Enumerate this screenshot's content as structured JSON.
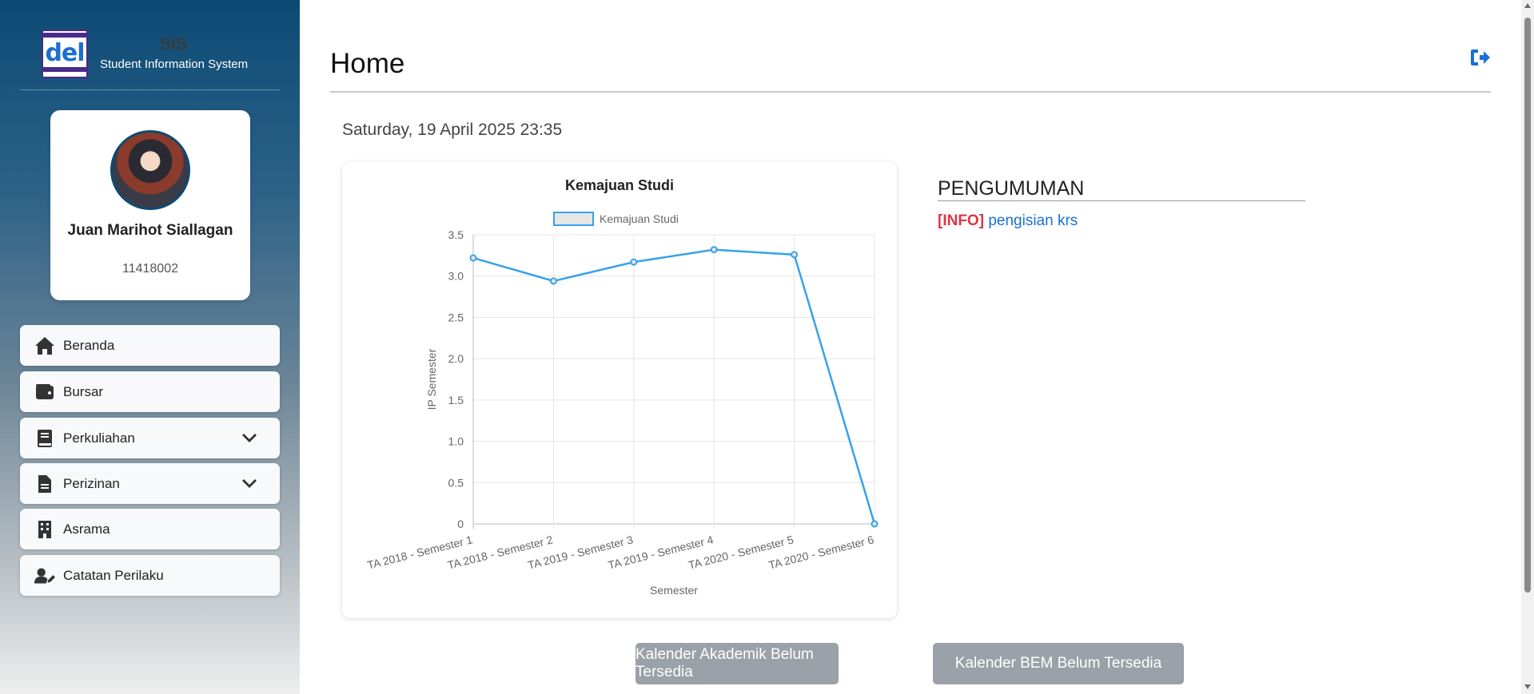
{
  "brand": {
    "logo_text": "del",
    "title": "SIS",
    "subtitle": "Student Information System"
  },
  "profile": {
    "name": "Juan Marihot Siallagan",
    "student_id": "11418002"
  },
  "sidebar": {
    "items": [
      {
        "label": "Beranda",
        "icon": "home-icon"
      },
      {
        "label": "Bursar",
        "icon": "wallet-icon"
      },
      {
        "label": "Perkuliahan",
        "icon": "book-icon",
        "expandable": true
      },
      {
        "label": "Perizinan",
        "icon": "file-icon",
        "expandable": true
      },
      {
        "label": "Asrama",
        "icon": "building-icon"
      },
      {
        "label": "Catatan Perilaku",
        "icon": "user-edit-icon"
      }
    ]
  },
  "header": {
    "title": "Home",
    "logout_icon": "sign-out-icon"
  },
  "datetime": "Saturday, 19 April 2025 23:35",
  "chart_data": {
    "type": "line",
    "title": "Kemajuan Studi",
    "legend": "top",
    "xlabel": "Semester",
    "ylabel": "IP Semester",
    "ylim": [
      0,
      3.5
    ],
    "yticks": [
      "0",
      "0.5",
      "1.0",
      "1.5",
      "2.0",
      "2.5",
      "3.0",
      "3.5"
    ],
    "grid": true,
    "categories": [
      "TA 2018 - Semester 1",
      "TA 2018 - Semester 2",
      "TA 2019 - Semester 3",
      "TA 2019 - Semester 4",
      "TA 2020 - Semester 5",
      "TA 2020 - Semester 6"
    ],
    "series": [
      {
        "name": "Kemajuan Studi",
        "values": [
          3.22,
          2.94,
          3.17,
          3.32,
          3.26,
          0
        ],
        "color": "#36a2eb"
      }
    ]
  },
  "announcements": {
    "title": "PENGUMUMAN",
    "items": [
      {
        "tag": "[INFO]",
        "text": "pengisian krs"
      }
    ]
  },
  "calendar_buttons": {
    "akademik": "Kalender Akademik Belum Tersedia",
    "bem": "Kalender BEM Belum Tersedia"
  },
  "colors": {
    "accent": "#1a6fd8",
    "info_tag": "#dc3545",
    "sidebar_top": "#0c4a74",
    "button_disabled": "#9aa1a8"
  }
}
